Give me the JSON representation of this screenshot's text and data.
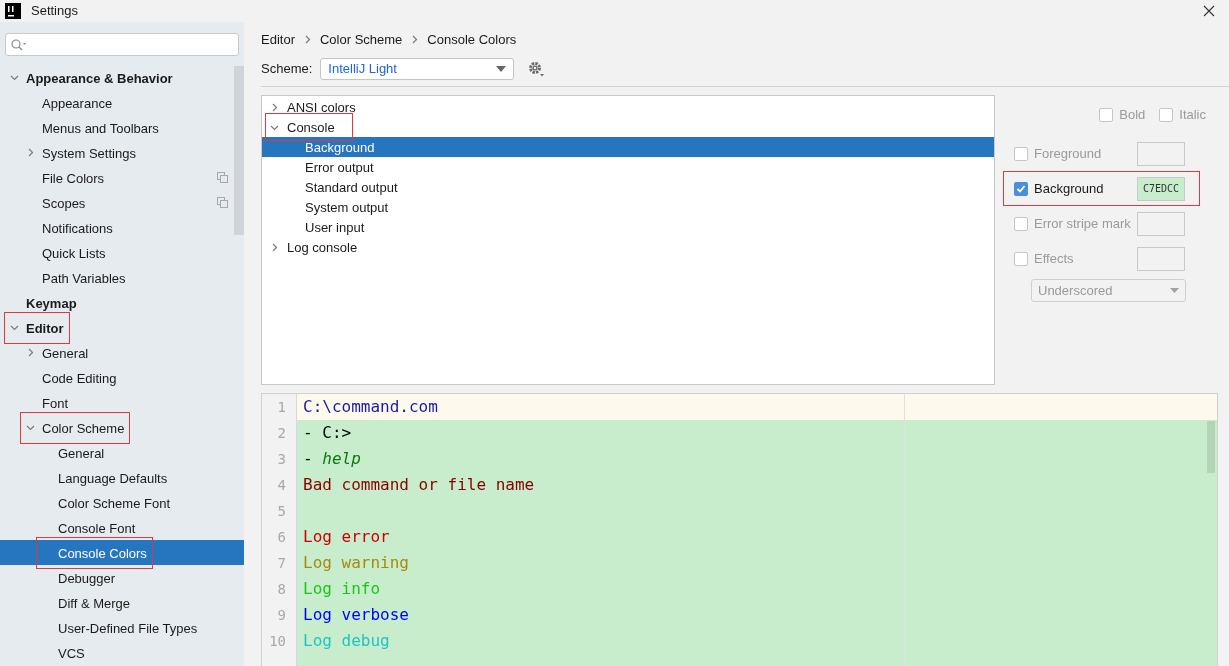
{
  "window": {
    "title": "Settings"
  },
  "sidebar": {
    "items": [
      {
        "label": "Appearance & Behavior",
        "bold": true,
        "expanded": true,
        "selected": false,
        "children": [
          {
            "label": "Appearance",
            "selected": false
          },
          {
            "label": "Menus and Toolbars",
            "selected": false
          },
          {
            "label": "System Settings",
            "expanded": false,
            "selected": false
          },
          {
            "label": "File Colors",
            "project_badge": true,
            "selected": false
          },
          {
            "label": "Scopes",
            "project_badge": true,
            "selected": false
          },
          {
            "label": "Notifications",
            "selected": false
          },
          {
            "label": "Quick Lists",
            "selected": false
          },
          {
            "label": "Path Variables",
            "selected": false
          }
        ]
      },
      {
        "label": "Keymap",
        "bold": true,
        "selected": false
      },
      {
        "label": "Editor",
        "bold": true,
        "expanded": true,
        "selected": false,
        "marked": true,
        "children": [
          {
            "label": "General",
            "expanded": false,
            "selected": false
          },
          {
            "label": "Code Editing",
            "selected": false
          },
          {
            "label": "Font",
            "selected": false
          },
          {
            "label": "Color Scheme",
            "expanded": true,
            "selected": false,
            "marked": true,
            "children": [
              {
                "label": "General",
                "selected": false
              },
              {
                "label": "Language Defaults",
                "selected": false
              },
              {
                "label": "Color Scheme Font",
                "selected": false
              },
              {
                "label": "Console Font",
                "selected": false
              },
              {
                "label": "Console Colors",
                "selected": true,
                "marked": true
              },
              {
                "label": "Debugger",
                "selected": false
              },
              {
                "label": "Diff & Merge",
                "selected": false
              },
              {
                "label": "User-Defined File Types",
                "selected": false
              },
              {
                "label": "VCS",
                "selected": false
              }
            ]
          }
        ]
      }
    ]
  },
  "breadcrumb": [
    "Editor",
    "Color Scheme",
    "Console Colors"
  ],
  "scheme": {
    "label": "Scheme:",
    "value": "IntelliJ Light"
  },
  "element_tree": [
    {
      "label": "ANSI colors",
      "expanded": false,
      "selected": false
    },
    {
      "label": "Console",
      "expanded": true,
      "selected": false,
      "marked": true,
      "children": [
        {
          "label": "Background",
          "selected": true
        },
        {
          "label": "Error output",
          "selected": false
        },
        {
          "label": "Standard output",
          "selected": false
        },
        {
          "label": "System output",
          "selected": false
        },
        {
          "label": "User input",
          "selected": false
        }
      ]
    },
    {
      "label": "Log console",
      "expanded": false,
      "selected": false
    }
  ],
  "font_style": [
    {
      "label": "Bold",
      "checked": false
    },
    {
      "label": "Italic",
      "checked": false
    }
  ],
  "attributes": [
    {
      "label": "Foreground",
      "checked": false
    },
    {
      "label": "Background",
      "checked": true,
      "marked": true,
      "value": "C7EDCC",
      "color": "#c7edcc"
    },
    {
      "label": "Error stripe mark",
      "checked": false
    },
    {
      "label": "Effects",
      "checked": false
    }
  ],
  "effect_type": {
    "value": "Underscored",
    "disabled": true
  },
  "preview": {
    "lines": [
      {
        "number": "1",
        "current": true,
        "segments": [
          {
            "text": "C:\\command.com",
            "color": "#1a1aa6"
          }
        ]
      },
      {
        "number": "2",
        "current": false,
        "segments": [
          {
            "text": "- ",
            "color": "#000000"
          },
          {
            "text": "C:>",
            "color": "#000000"
          }
        ]
      },
      {
        "number": "3",
        "current": false,
        "segments": [
          {
            "text": "- ",
            "color": "#000000"
          },
          {
            "text": "help",
            "color": "#0b7a0b",
            "italic": true
          }
        ]
      },
      {
        "number": "4",
        "current": false,
        "segments": [
          {
            "text": "Bad command or file name",
            "color": "#8b0000"
          }
        ]
      },
      {
        "number": "5",
        "current": false
      },
      {
        "number": "6",
        "current": false,
        "segments": [
          {
            "text": "Log error",
            "color": "#cc0000"
          }
        ]
      },
      {
        "number": "7",
        "current": false,
        "segments": [
          {
            "text": "Log warning",
            "color": "#a68a0d"
          }
        ]
      },
      {
        "number": "8",
        "current": false,
        "segments": [
          {
            "text": "Log info",
            "color": "#1bc61b"
          }
        ]
      },
      {
        "number": "9",
        "current": false,
        "segments": [
          {
            "text": "Log verbose",
            "color": "#0000ff"
          }
        ]
      },
      {
        "number": "10",
        "current": false,
        "segments": [
          {
            "text": "Log debug",
            "color": "#20c4c4"
          }
        ]
      }
    ]
  }
}
